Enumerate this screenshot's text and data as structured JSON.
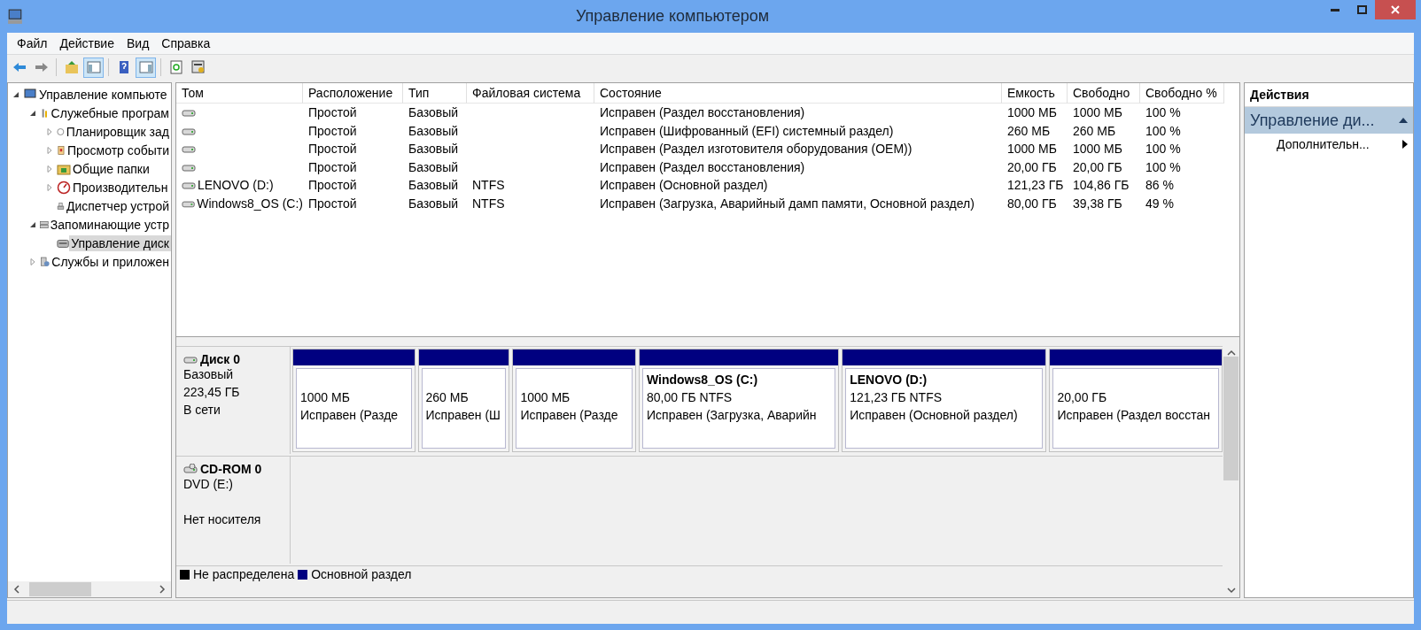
{
  "window": {
    "title": "Управление компьютером"
  },
  "menu": [
    "Файл",
    "Действие",
    "Вид",
    "Справка"
  ],
  "toolbar": [
    {
      "kind": "back",
      "pressed": false
    },
    {
      "kind": "forward",
      "pressed": false
    },
    {
      "kind": "sep"
    },
    {
      "kind": "up",
      "pressed": false
    },
    {
      "kind": "tree",
      "pressed": true
    },
    {
      "kind": "sep"
    },
    {
      "kind": "help",
      "pressed": false
    },
    {
      "kind": "pane",
      "pressed": true
    },
    {
      "kind": "sep"
    },
    {
      "kind": "refresh",
      "pressed": false
    },
    {
      "kind": "props",
      "pressed": false
    }
  ],
  "tree": [
    {
      "label": "Управление компьюте",
      "kind": "computer",
      "expanded": true,
      "selected": false,
      "children": [
        {
          "label": "Служебные програм",
          "kind": "tools",
          "expanded": true,
          "selected": false,
          "children": [
            {
              "label": "Планировщик зад",
              "kind": "clock",
              "expanded": false,
              "selected": false
            },
            {
              "label": "Просмотр событи",
              "kind": "log",
              "expanded": false,
              "selected": false
            },
            {
              "label": "Общие папки",
              "kind": "folder",
              "expanded": false,
              "selected": false
            },
            {
              "label": "Производительн",
              "kind": "gauge",
              "expanded": false,
              "selected": false
            },
            {
              "label": "Диспетчер устрой",
              "kind": "device",
              "selected": false
            }
          ]
        },
        {
          "label": "Запоминающие устр",
          "kind": "storage",
          "expanded": true,
          "selected": false,
          "children": [
            {
              "label": "Управление диск",
              "kind": "disk",
              "selected": true
            }
          ]
        },
        {
          "label": "Службы и приложен",
          "kind": "services",
          "expanded": false,
          "selected": false
        }
      ]
    }
  ],
  "table": {
    "columns": [
      "Том",
      "Расположение",
      "Тип",
      "Файловая система",
      "Состояние",
      "Емкость",
      "Свободно",
      "Свободно %"
    ],
    "rows": [
      [
        "",
        "Простой",
        "Базовый",
        "",
        "Исправен (Раздел восстановления)",
        "1000 МБ",
        "1000 МБ",
        "100 %"
      ],
      [
        "",
        "Простой",
        "Базовый",
        "",
        "Исправен (Шифрованный (EFI) системный раздел)",
        "260 МБ",
        "260 МБ",
        "100 %"
      ],
      [
        "",
        "Простой",
        "Базовый",
        "",
        "Исправен (Раздел изготовителя оборудования (OEM))",
        "1000 МБ",
        "1000 МБ",
        "100 %"
      ],
      [
        "",
        "Простой",
        "Базовый",
        "",
        "Исправен (Раздел восстановления)",
        "20,00 ГБ",
        "20,00 ГБ",
        "100 %"
      ],
      [
        "LENOVO (D:)",
        "Простой",
        "Базовый",
        "NTFS",
        "Исправен (Основной раздел)",
        "121,23 ГБ",
        "104,86 ГБ",
        "86 %"
      ],
      [
        "Windows8_OS (C:)",
        "Простой",
        "Базовый",
        "NTFS",
        "Исправен (Загрузка, Аварийный дамп памяти, Основной раздел)",
        "80,00 ГБ",
        "39,38 ГБ",
        "49 %"
      ]
    ]
  },
  "disks": [
    {
      "name": "Диск 0",
      "kind": "hdd",
      "lines": [
        "Базовый",
        "223,45 ГБ",
        "В сети"
      ],
      "partitions": [
        {
          "size": "1000 МБ",
          "status": "Исправен (Разде",
          "color": "#000080"
        },
        {
          "size": "260 МБ",
          "status": "Исправен (Ш",
          "color": "#000080"
        },
        {
          "size": "1000 МБ",
          "status": "Исправен (Разде",
          "color": "#000080"
        },
        {
          "title": "Windows8_OS  (C:)",
          "size": "80,00 ГБ NTFS",
          "status": "Исправен (Загрузка, Аварийн",
          "color": "#000080"
        },
        {
          "title": "LENOVO  (D:)",
          "size": "121,23 ГБ NTFS",
          "status": "Исправен (Основной раздел)",
          "color": "#000080"
        },
        {
          "size": "20,00 ГБ",
          "status": "Исправен (Раздел восстан",
          "color": "#000080"
        }
      ]
    },
    {
      "name": "CD-ROM 0",
      "kind": "cdrom",
      "lines": [
        "DVD (E:)",
        "Нет носителя"
      ]
    }
  ],
  "legend": [
    {
      "label": "Не распределена",
      "color": "#000000"
    },
    {
      "label": "Основной раздел",
      "color": "#000080"
    }
  ],
  "actions": {
    "title": "Действия",
    "section": {
      "label": "Управление ди...",
      "expanded": true
    },
    "items": [
      "Дополнительн..."
    ]
  }
}
